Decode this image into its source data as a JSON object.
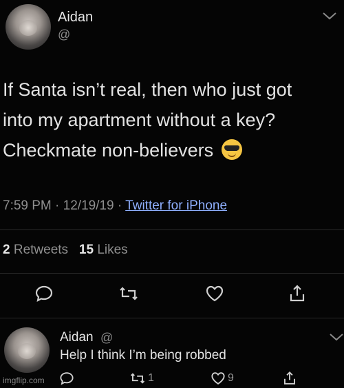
{
  "tweet": {
    "author_name": "Aidan",
    "author_handle": "@",
    "text_line1": "If Santa isn’t real, then who just got",
    "text_line2": "into my apartment without a key?",
    "text_line3": "Checkmate non-believers",
    "emoji": "sunglasses-face",
    "time": "7:59 PM",
    "date": "12/19/19",
    "separator": "·",
    "source": "Twitter for iPhone",
    "retweets_count": "2",
    "retweets_label": "Retweets",
    "likes_count": "15",
    "likes_label": "Likes"
  },
  "reply": {
    "author_name": "Aidan",
    "author_handle": "@",
    "text": "Help I think I’m being robbed",
    "retweet_count": "1",
    "like_count": "9"
  },
  "watermark": "imgflip.com",
  "colors": {
    "background": "#050505",
    "text": "#e2e2e2",
    "muted": "#8f8f8f",
    "link": "#8fb0ff",
    "divider": "#2a2a2a"
  },
  "icons": [
    "reply-icon",
    "retweet-icon",
    "like-icon",
    "share-icon",
    "chevron-down-icon"
  ]
}
